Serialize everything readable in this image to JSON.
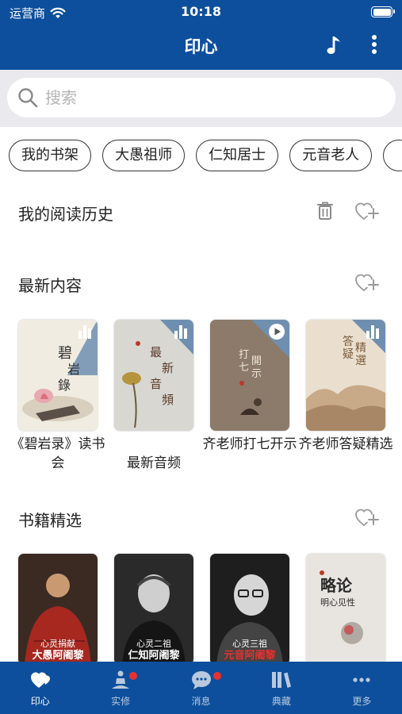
{
  "status_bar": {
    "carrier": "运营商",
    "time": "10:18"
  },
  "nav": {
    "title": "印心",
    "music_icon": "music-note-icon",
    "more_icon": "more-vertical-icon"
  },
  "search": {
    "placeholder": "搜索"
  },
  "chips": [
    "我的书架",
    "大愚祖师",
    "仁知居士",
    "元音老人",
    ""
  ],
  "history": {
    "title": "我的阅读历史"
  },
  "latest": {
    "title": "最新内容",
    "items": [
      {
        "title": "《碧岩录》读书会",
        "cover_text": "碧岩錄",
        "badge": "chart-icon"
      },
      {
        "title": "最新音频",
        "cover_text": "最新音頻",
        "badge": "chart-icon"
      },
      {
        "title": "齐老师打七开示",
        "cover_text": "打七開示",
        "badge": "play-icon"
      },
      {
        "title": "齐老师答疑精选",
        "cover_text": "答疑精選",
        "badge": "chart-icon"
      }
    ]
  },
  "books": {
    "title": "书籍精选",
    "items": [
      {
        "cover_line1": "心灵捐献",
        "cover_line2": "大愚阿阇黎"
      },
      {
        "cover_line1": "心灵二祖",
        "cover_line2": "仁知阿阇黎"
      },
      {
        "cover_line1": "心灵三祖",
        "cover_line2": "元音阿阇黎"
      },
      {
        "cover_line1": "略论",
        "cover_line2": "明心见性"
      }
    ]
  },
  "tabs": [
    {
      "label": "印心",
      "icon": "heart-icon",
      "active": true,
      "badge": false
    },
    {
      "label": "实修",
      "icon": "meditation-icon",
      "active": false,
      "badge": true
    },
    {
      "label": "消息",
      "icon": "chat-icon",
      "active": false,
      "badge": true
    },
    {
      "label": "典藏",
      "icon": "books-icon",
      "active": false,
      "badge": false
    },
    {
      "label": "更多",
      "icon": "more-horizontal-icon",
      "active": false,
      "badge": false
    }
  ],
  "colors": {
    "primary": "#0d4f9c",
    "badge": "#e8312f",
    "chip_border": "#333333"
  }
}
